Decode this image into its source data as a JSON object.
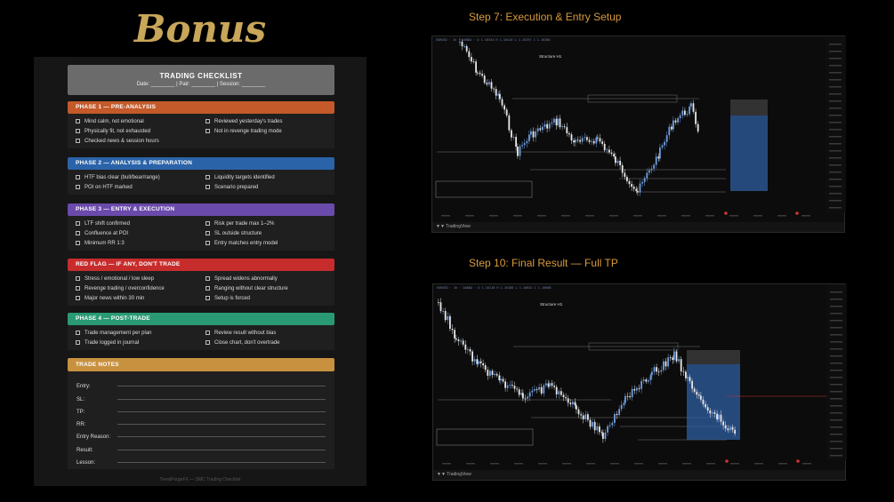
{
  "title": "Bonus",
  "checklist": {
    "title": "TRADING CHECKLIST",
    "subtitle": "Date: ________ | Pair: ________ | Session: ________",
    "phases": [
      {
        "name": "PHASE 1 — PRE-ANALYSIS",
        "color": "#c4592a",
        "left": [
          "Mind calm, not emotional",
          "Physically fit, not exhausted",
          "Checked news & session hours"
        ],
        "right": [
          "Reviewed yesterday's trades",
          "Not in revenge trading mode"
        ]
      },
      {
        "name": "PHASE 2 — ANALYSIS & PREPARATION",
        "color": "#2b63a8",
        "left": [
          "HTF bias clear (bull/bear/range)",
          "POI on HTF marked"
        ],
        "right": [
          "Liquidity targets identified",
          "Scenario prepared"
        ]
      },
      {
        "name": "PHASE 3 — ENTRY & EXECUTION",
        "color": "#6a4aaa",
        "left": [
          "LTF shift confirmed",
          "Confluence at POI",
          "Minimum RR 1:3"
        ],
        "right": [
          "Risk per trade max 1–2%",
          "SL outside structure",
          "Entry matches entry model"
        ]
      },
      {
        "name": "RED FLAG — IF ANY, DON'T TRADE",
        "color": "#c72c2c",
        "left": [
          "Stress / emotional / low sleep",
          "Revenge trading / overconfidence",
          "Major news within 30 min"
        ],
        "right": [
          "Spread widens abnormally",
          "Ranging without clear structure",
          "Setup is forced"
        ]
      },
      {
        "name": "PHASE 4 — POST-TRADE",
        "color": "#2a9a74",
        "left": [
          "Trade management per plan",
          "Trade logged in journal"
        ],
        "right": [
          "Review result without bias",
          "Close chart, don't overtrade"
        ]
      }
    ],
    "notes": {
      "name": "TRADE NOTES",
      "color": "#c8913f",
      "fields": [
        "Entry:",
        "SL:",
        "TP:",
        "RR:",
        "Entry Reason:",
        "Result:",
        "Lesson:"
      ]
    },
    "footer": "TrendForgeFX — SMC Trading Checklist"
  },
  "charts": [
    {
      "heading": "Step 7: Execution & Entry Setup",
      "label": "Structure H1",
      "brand": "TradingView"
    },
    {
      "heading": "Step 10: Final Result — Full TP",
      "label": "Structure H1",
      "brand": "TradingView"
    }
  ],
  "colors": {
    "accent": "#c8a65a",
    "step": "#d99a3e",
    "candle_blue": "#5b8fd6",
    "zone_blue": "#2f5ea0"
  }
}
